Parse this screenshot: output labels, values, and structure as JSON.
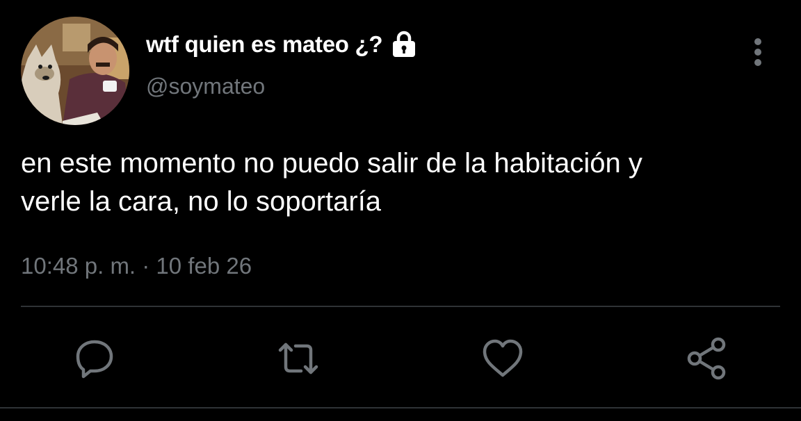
{
  "user": {
    "display_name": "wtf quien es mateo ¿?",
    "handle": "@soymateo",
    "protected_icon": "lock-icon",
    "avatar_icon": "profile-avatar"
  },
  "tweet": {
    "text_line_1": "en este momento no puedo salir de la habitación y",
    "text_line_2": "verle la cara, no lo soportaría",
    "timestamp": "10:48 p. m. · 10 feb 26"
  },
  "actions": {
    "reply_icon": "reply-icon",
    "retweet_icon": "retweet-icon",
    "like_icon": "heart-icon",
    "share_icon": "share-icon",
    "more_icon": "more-vertical-icon"
  },
  "colors": {
    "background": "#000000",
    "text_primary": "#ffffff",
    "text_secondary": "#71767b",
    "divider": "#2f3336",
    "icon": "#71767b"
  }
}
